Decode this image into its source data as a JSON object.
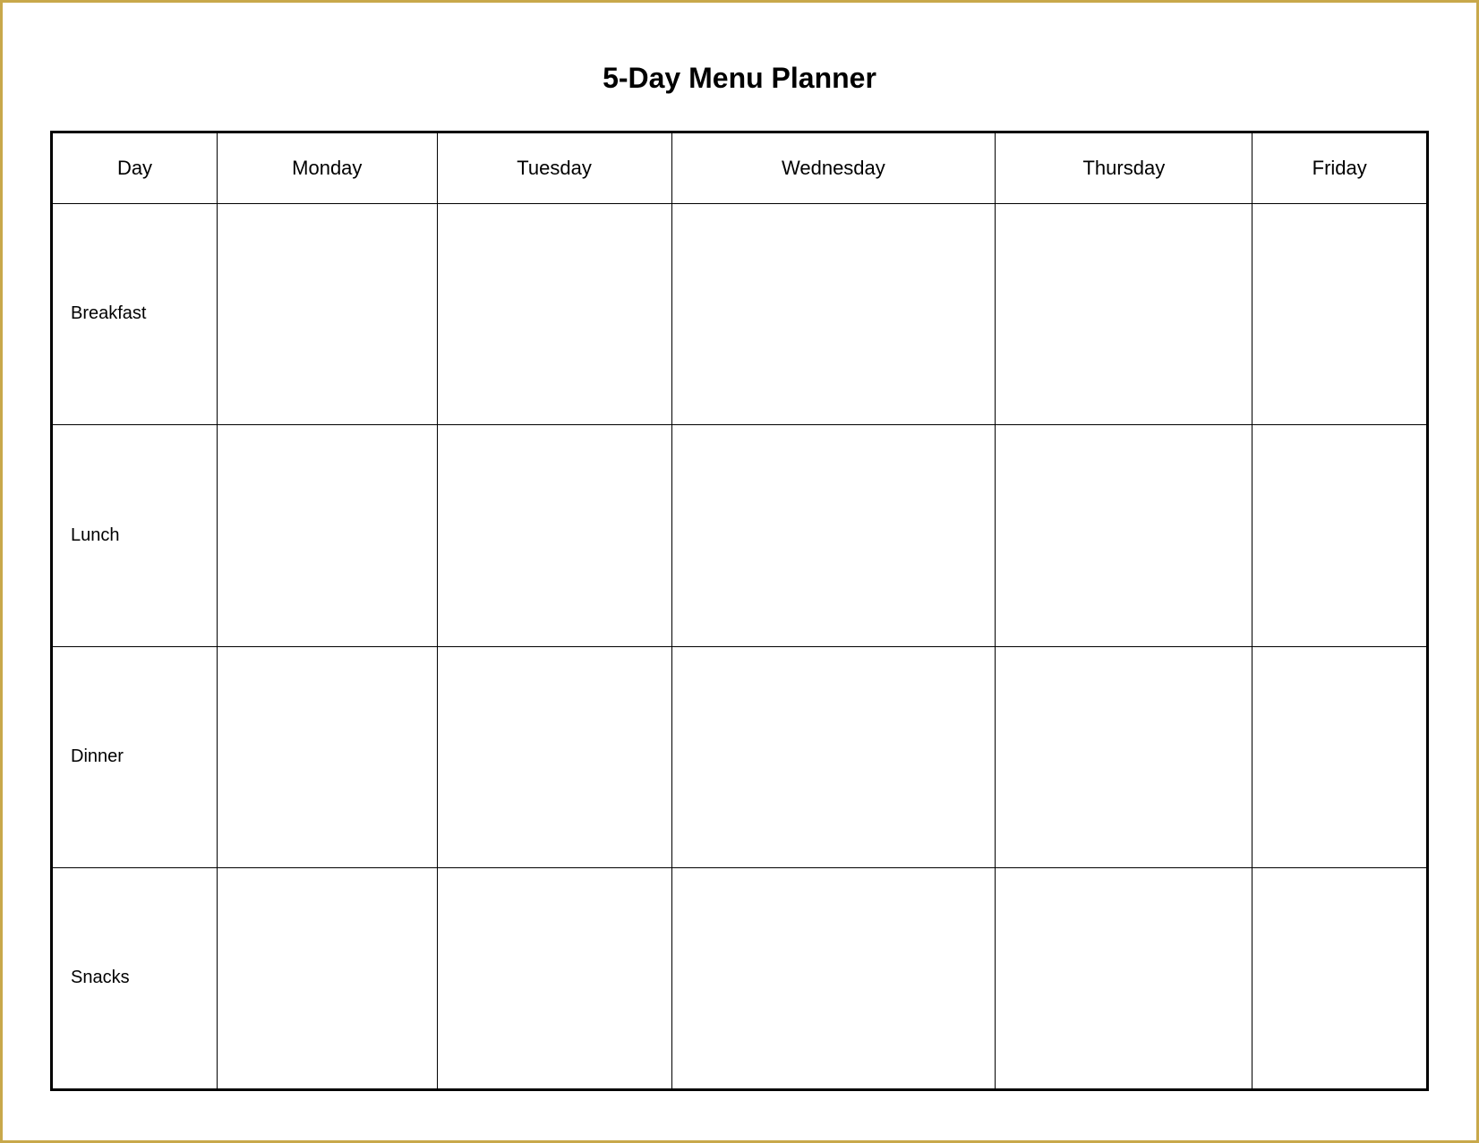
{
  "title": "5-Day Menu Planner",
  "columns": {
    "day": "Day",
    "monday": "Monday",
    "tuesday": "Tuesday",
    "wednesday": "Wednesday",
    "thursday": "Thursday",
    "friday": "Friday"
  },
  "rows": {
    "breakfast": "Breakfast",
    "lunch": "Lunch",
    "dinner": "Dinner",
    "snacks": "Snacks"
  }
}
